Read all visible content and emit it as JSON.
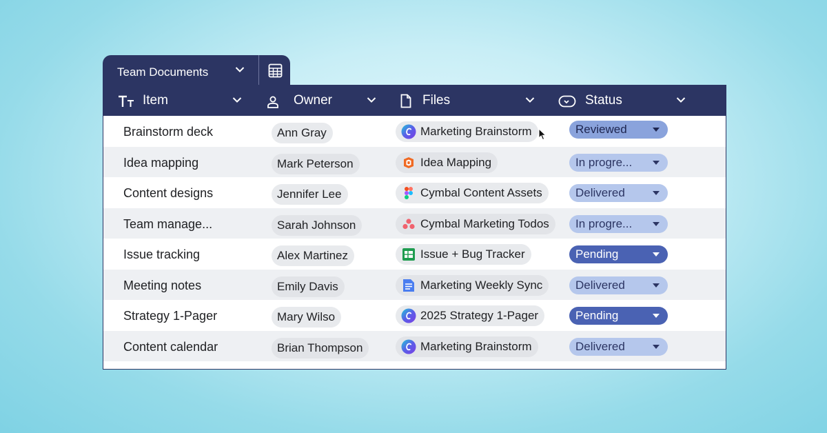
{
  "tab": {
    "title": "Team Documents"
  },
  "headers": [
    {
      "label": "Item",
      "icon": "text-format-icon"
    },
    {
      "label": "Owner",
      "icon": "person-icon"
    },
    {
      "label": "Files",
      "icon": "file-icon"
    },
    {
      "label": "Status",
      "icon": "toggle-icon"
    }
  ],
  "rows": [
    {
      "item": "Brainstorm deck",
      "owner": "Ann Gray",
      "file": "Marketing Brainstorm",
      "file_icon": "canva-icon",
      "status": "Reviewed",
      "status_style": "mid"
    },
    {
      "item": "Idea mapping",
      "owner": "Mark Peterson",
      "file": "Idea Mapping",
      "file_icon": "miro-icon",
      "status": "In progre...",
      "status_style": "light"
    },
    {
      "item": "Content designs",
      "owner": "Jennifer Lee",
      "file": "Cymbal Content Assets",
      "file_icon": "figma-icon",
      "status": "Delivered",
      "status_style": "light"
    },
    {
      "item": "Team manage...",
      "owner": "Sarah Johnson",
      "file": "Cymbal Marketing Todos",
      "file_icon": "asana-icon",
      "status": "In progre...",
      "status_style": "light"
    },
    {
      "item": "Issue tracking",
      "owner": "Alex Martinez",
      "file": "Issue + Bug Tracker",
      "file_icon": "sheets-icon",
      "status": "Pending",
      "status_style": "dark"
    },
    {
      "item": "Meeting notes",
      "owner": "Emily Davis",
      "file": "Marketing Weekly Sync",
      "file_icon": "docs-icon",
      "status": "Delivered",
      "status_style": "light"
    },
    {
      "item": "Strategy 1-Pager",
      "owner": "Mary Wilso",
      "file": "2025 Strategy 1-Pager",
      "file_icon": "canva-icon",
      "status": "Pending",
      "status_style": "dark"
    },
    {
      "item": "Content calendar",
      "owner": "Brian Thompson",
      "file": "Marketing Brainstorm",
      "file_icon": "canva-icon",
      "status": "Delivered",
      "status_style": "light"
    }
  ],
  "colors": {
    "header_bg": "#2c3563",
    "status_light": "#b5c7ec",
    "status_mid": "#8aa3dc",
    "status_dark": "#4a62b3"
  }
}
